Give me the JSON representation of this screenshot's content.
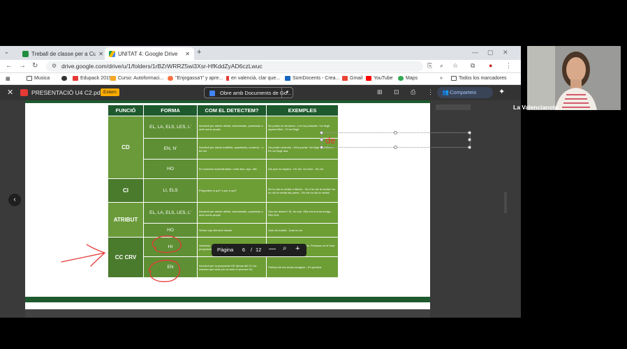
{
  "tabs": [
    {
      "label": "Treball de classe per a Curs vali",
      "active": false
    },
    {
      "label": "UNITAT 4: Google Drive",
      "active": true
    }
  ],
  "address": {
    "url": "drive.google.com/drive/u/1/folders/1rBZrWRRZ5wi3Xsr-HfKddZyAD6czLwuc"
  },
  "bookmarks": [
    "Musica",
    "Edupack 2019",
    "Curso: Autoformaci...",
    "\"Enjogassa't\" y apre...",
    "en valencià, clar que...",
    "SomDocents - Crea...",
    "Gmail",
    "YouTube",
    "Maps"
  ],
  "bookmarks_all": "Todos los marcadores",
  "viewer": {
    "file_title": "PRESENTACIÓ U4 C2.pdf",
    "badge": "Extern",
    "open_with": "Obre amb Documents de Go...",
    "share": "Comparteix"
  },
  "table": {
    "headers": [
      "FUNCIÓ",
      "FORMA",
      "COM EL DETECTEM?",
      "EXEMPLES"
    ],
    "rows": [
      {
        "funcio": "CD",
        "forma": "EL, LA, ELS, LES, L'",
        "detectem": "Introduït per article definit, demostratiu, possessiu o amb noms propis",
        "exemples": "No portat no verdures - Les ha portades. Vol llegir aquest llibre - El vol llegir"
      },
      {
        "funcio": "",
        "forma": "EN, N'",
        "detectem": "Introduït per article indefinit, quantitatiu, numeral... o bé res",
        "exemples": "Ha portat verdures - N'ha portat. Vol llegir dos llibres - En vol llegir dos"
      },
      {
        "funcio": "",
        "forma": "HO",
        "detectem": "En oracions subordinades i amb això, açò, allò",
        "exemples": "Diu que no espera - Ho diu. Vol això - Ho vol"
      },
      {
        "funcio": "CI",
        "forma": "LI, ELS",
        "detectem": "Preguntem a qui? o per a qui?",
        "exemples": "No ho diu la veritat a Martín - No li ho diu la veritat. No ho diu la veritat als pares - No els ho diu la veritat"
      },
      {
        "funcio": "ATRIBUT",
        "forma": "EL, LA, ELS, LES, L'",
        "detectem": "Introduït per article definit, demostratiu, possessiu o amb noms propis",
        "exemples": "Són les dutxes? Sí, les són. Ella era la teua amiga - Ella l'era"
      },
      {
        "funcio": "",
        "forma": "HO",
        "detectem": "Sense cap element davant",
        "exemples": "Joan és malalt - Joan ho és"
      },
      {
        "funcio": "CC CRV",
        "forma": "HI",
        "detectem": "Adverbis, sintagmes nominals i complements preposicionals",
        "exemples": "Va anclar a l'oficina - Hi va anclar. Pensava en el futur - Hi pensava"
      },
      {
        "funcio": "",
        "forma": "EN",
        "detectem": "Introduït per la preposició DE (llevat del CC de manera que serà per va amb el pronom HI)",
        "exemples": "Parlava de les seues amigues - En parlava"
      }
    ]
  },
  "textbox": {
    "text": "de"
  },
  "pager": {
    "label": "Pàgina",
    "current": "6",
    "separator": "/",
    "total": "12",
    "minus": "—",
    "plus": "+"
  },
  "webcam": {
    "name": "La Valencianota"
  }
}
